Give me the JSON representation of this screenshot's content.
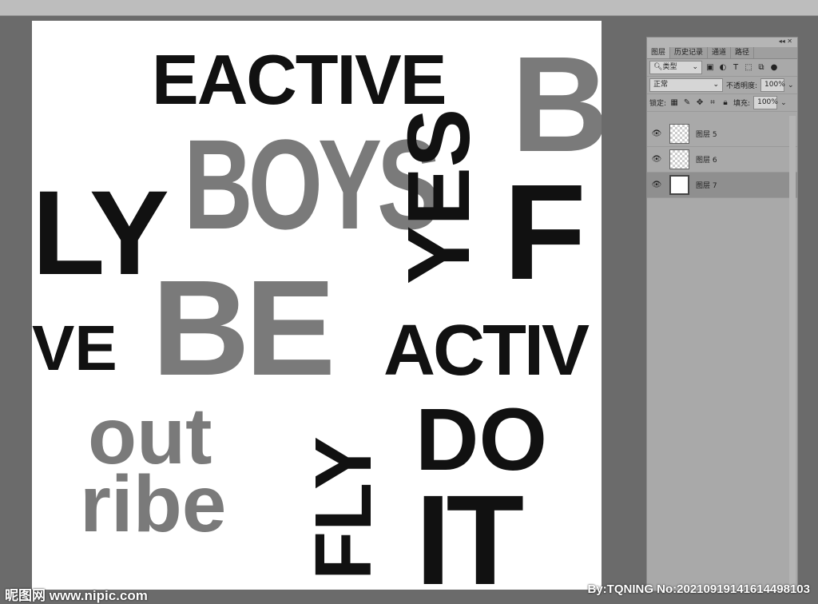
{
  "panel": {
    "tabs": [
      "图层",
      "历史记录",
      "通道",
      "路径"
    ],
    "filter_kind": "类型",
    "blend_mode": "正常",
    "opacity_label": "不透明度:",
    "opacity": "100%",
    "lock_label": "锁定:",
    "fill_label": "填充:",
    "fill": "100%",
    "layers": [
      {
        "name": "图层 5"
      },
      {
        "name": "图层 6"
      },
      {
        "name": "图层 7"
      }
    ]
  },
  "artwork": {
    "words": [
      "EACTIVE",
      "B",
      "BOYS",
      "YES",
      "LY",
      "BE",
      "ACTIV",
      "VE",
      "DO",
      "FLY",
      "IT",
      "out",
      "ribe",
      "F"
    ]
  },
  "watermark": {
    "left": "昵图网 www.nipic.com",
    "right": "By:TQNING No:20210919141614498103"
  }
}
